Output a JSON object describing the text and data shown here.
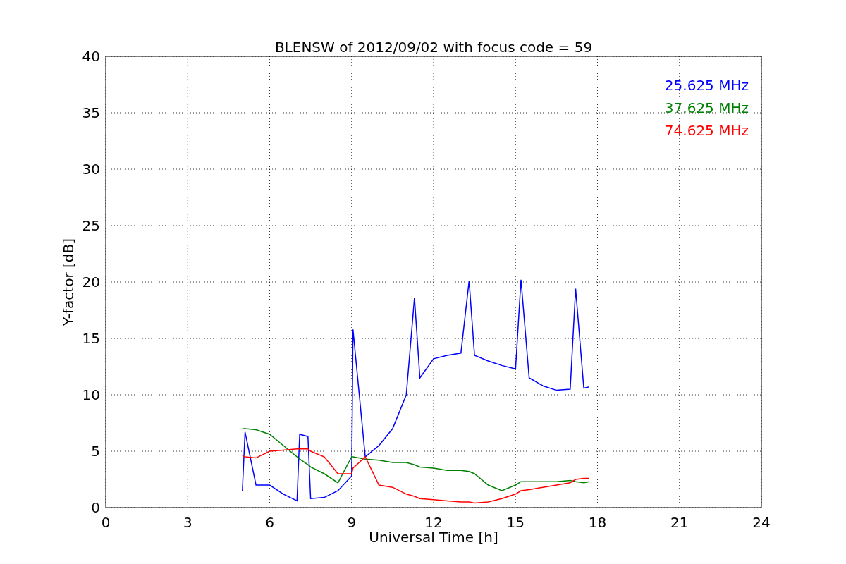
{
  "figure": {
    "chart_data": {
      "type": "line",
      "title": "BLENSW of 2012/09/02 with focus code = 59",
      "xlabel": "Universal Time [h]",
      "ylabel": "Y-factor [dB]",
      "x": [
        5,
        5.1,
        5.5,
        6,
        6.5,
        7,
        7.1,
        7.4,
        7.5,
        8,
        8.5,
        9,
        9.05,
        9.5,
        10,
        10.5,
        11,
        11.3,
        11.5,
        12,
        12.5,
        13,
        13.3,
        13.5,
        14,
        14.5,
        15,
        15.2,
        15.5,
        16,
        16.5,
        17,
        17.2,
        17.5,
        17.7
      ],
      "series": [
        {
          "name": "25.625 MHz",
          "color": "#0000ff",
          "values": [
            1.5,
            6.7,
            2.0,
            2.0,
            1.2,
            0.6,
            6.5,
            6.3,
            0.8,
            0.9,
            1.5,
            2.8,
            15.8,
            4.5,
            5.5,
            7,
            10,
            18.6,
            11.5,
            13.2,
            13.5,
            13.7,
            20.1,
            13.5,
            13,
            12.6,
            12.3,
            20.2,
            11.5,
            10.8,
            10.4,
            10.5,
            19.4,
            10.6,
            10.7
          ]
        },
        {
          "name": "37.625 MHz",
          "color": "#008000",
          "values": [
            7.0,
            7.0,
            6.9,
            6.5,
            5.5,
            4.5,
            4.3,
            3.8,
            3.6,
            3.0,
            2.2,
            4.5,
            4.5,
            4.3,
            4.2,
            4.0,
            4.0,
            3.8,
            3.6,
            3.5,
            3.3,
            3.3,
            3.2,
            3.0,
            2.0,
            1.5,
            2.0,
            2.3,
            2.3,
            2.3,
            2.3,
            2.4,
            2.3,
            2.2,
            2.3
          ]
        },
        {
          "name": "74.625 MHz",
          "color": "#ff0000",
          "values": [
            4.6,
            4.5,
            4.4,
            5.0,
            5.1,
            5.2,
            5.2,
            5.2,
            5.0,
            4.5,
            3.0,
            3.0,
            3.5,
            4.5,
            2.0,
            1.8,
            1.2,
            1.0,
            0.8,
            0.7,
            0.6,
            0.5,
            0.5,
            0.4,
            0.5,
            0.8,
            1.2,
            1.5,
            1.6,
            1.8,
            2.0,
            2.2,
            2.5,
            2.6,
            2.6
          ]
        }
      ],
      "grid": true,
      "xlim": [
        0,
        24
      ],
      "ylim": [
        0,
        40
      ],
      "xticks": [
        0,
        3,
        6,
        9,
        12,
        15,
        18,
        21,
        24
      ],
      "yticks": [
        0,
        5,
        10,
        15,
        20,
        25,
        30,
        35,
        40
      ]
    }
  }
}
